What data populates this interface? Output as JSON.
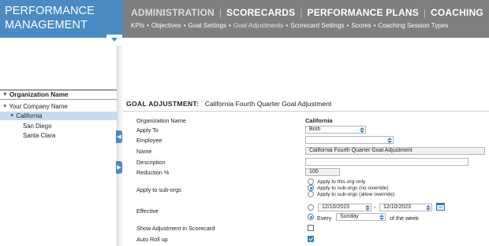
{
  "brand": {
    "title": "PERFORMANCE\nMANAGEMENT"
  },
  "nav": {
    "main": [
      "ADMINISTRATION",
      "SCORECARDS",
      "PERFORMANCE PLANS",
      "COACHING"
    ],
    "sub": [
      "KPIs",
      "Objectives",
      "Goal Settings",
      "Goal Adjustments",
      "Scorecard Settings",
      "Scores",
      "Coaching Session Types"
    ]
  },
  "tree": {
    "header": "Organization Name",
    "items": [
      {
        "label": "Your Company Name",
        "level": 0,
        "expanded": true
      },
      {
        "label": "California",
        "level": 1,
        "expanded": true,
        "selected": true
      },
      {
        "label": "San Diego",
        "level": 2
      },
      {
        "label": "Santa Clara",
        "level": 2
      }
    ]
  },
  "form": {
    "title_label": "GOAL ADJUSTMENT:",
    "title_value": " ` California Fourth Quarter Goal Adjustment",
    "fields": {
      "org_label": "Organization Name",
      "org_value": "California",
      "apply_to_label": "Apply To",
      "apply_to_value": "Both",
      "employee_label": "Employee",
      "employee_value": "",
      "name_label": "Name",
      "name_value": "California Fourth Quarter Goal Adjustment",
      "description_label": "Description",
      "description_value": "",
      "reduction_label": "Reduction %",
      "reduction_value": "100",
      "suborgs_label": "Apply to sub-orgs",
      "suborgs_options": [
        "Apply to this org only",
        "Apply to sub-orgs (no override)",
        "Apply to sub-orgs (allow override)"
      ],
      "suborgs_selected": 1,
      "effective_label": "Effective",
      "effective_from": "12/10/2023",
      "effective_dash": "-",
      "effective_to": "12/10/2023",
      "every_label": "Every",
      "every_day": "Sunday",
      "of_week_label": "of the week",
      "show_adj_label": "Show Adjustment in Scorecard",
      "show_adj_checked": false,
      "auto_rollup_label": "Auto Roll up",
      "auto_rollup_checked": true
    }
  },
  "colors": {
    "brand": "#4a8bc4",
    "nav": "#7f7f7f",
    "selection": "#c5dcf0",
    "accent": "#3c7fc0"
  }
}
